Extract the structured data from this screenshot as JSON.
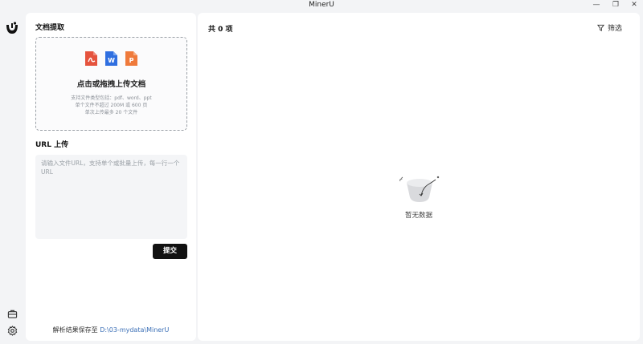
{
  "window": {
    "title": "MinerU",
    "minimize": "—",
    "restore": "❐",
    "close": "✕"
  },
  "rail": {
    "logo_icon": "mineru-logo-icon",
    "bottom_icons": [
      "toolbox-icon",
      "gear-icon"
    ]
  },
  "left": {
    "doc_section_title": "文档提取",
    "dropzone": {
      "file_types": [
        {
          "name": "pdf-file-icon",
          "letter": "",
          "color": "#e5533d"
        },
        {
          "name": "word-file-icon",
          "letter": "W",
          "color": "#2f6fe0"
        },
        {
          "name": "ppt-file-icon",
          "letter": "P",
          "color": "#ef7a3b"
        }
      ],
      "main_text": "点击或拖拽上传文档",
      "hint_types": "支持文件类型包括：pdf、word、ppt",
      "hint_size": "单个文件不超过 200M 或 600 页",
      "hint_count": "单次上传最多 20 个文件"
    },
    "url_section_title": "URL 上传",
    "url_placeholder": "请输入文件URL，支持单个或批量上传，每一行一个URL",
    "submit_label": "提交",
    "save_prefix": "解析结果保存至",
    "save_path": "D:\\03-mydata\\MinerU"
  },
  "right": {
    "count_text": "共 0 项",
    "filter_label": "筛选",
    "empty_text": "暂无数据"
  }
}
